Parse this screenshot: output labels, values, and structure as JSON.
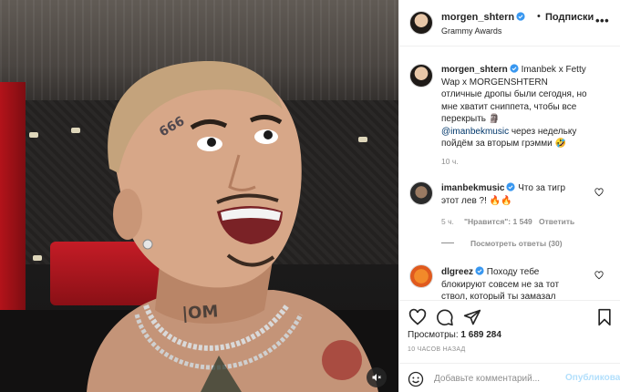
{
  "post": {
    "username": "morgen_shtern",
    "follow_label": "Подписки",
    "separator": "•",
    "location": "Grammy Awards",
    "more": "•••"
  },
  "caption": {
    "username": "morgen_shtern",
    "text_line1": "Imanbek x Fetty",
    "text_line2": "Wap x MORGENSHTERN",
    "text_line3": "отличные дропы были сегодня, но",
    "text_line4": "мне хватит сниппета, чтобы все",
    "text_line5": "перекрыть 🗿",
    "mention": "@imanbekmusic",
    "text_line6_rest": " через недельку",
    "text_line7": "пойдём за вторым грэмми 🤣",
    "time": "10 ч."
  },
  "comments": [
    {
      "username": "imanbekmusic",
      "line1": "Что за тигр",
      "line2": "этот лев ?! 🔥🔥",
      "time": "5 ч.",
      "likes": "\"Нравится\": 1 549",
      "reply": "Ответить",
      "view_replies": "Посмотреть ответы (30)"
    },
    {
      "username": "dlgreez",
      "line1": "Походу тебе",
      "line2": "блокируют совсем не за тот",
      "line3": "ствол, который ты замазал"
    }
  ],
  "stats": {
    "views_label": "Просмотры:",
    "views_value": "1 689 284",
    "timestamp": "10 часов назад"
  },
  "comment_box": {
    "placeholder": "Добавьте комментарий...",
    "publish": "Опубликовать"
  },
  "colors": {
    "verified": "#3897f0",
    "link": "#00376b",
    "publish_disabled": "#b2dffc"
  }
}
